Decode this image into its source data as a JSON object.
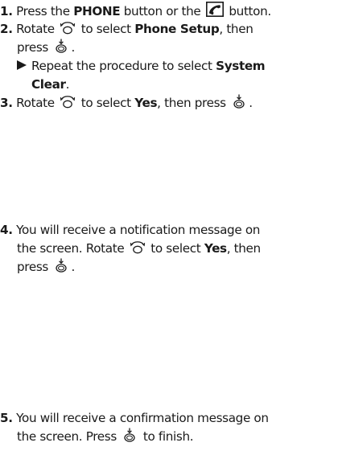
{
  "steps": [
    {
      "number": "1.",
      "lines": [
        {
          "t1": "Press the ",
          "b1": "PHONE",
          "t2": " button or the ",
          "t3": " button."
        }
      ]
    },
    {
      "number": "2.",
      "line1": {
        "t1": "Rotate ",
        "t2": " to select ",
        "b1": "Phone Setup",
        "t3": ", then"
      },
      "line2": {
        "t1": "press ",
        "t2": "."
      },
      "sub": {
        "t1": "Repeat the procedure to select ",
        "b1": "System"
      },
      "sub2": {
        "b1": "Clear",
        "t1": "."
      }
    },
    {
      "number": "3.",
      "line1": {
        "t1": "Rotate ",
        "t2": " to select ",
        "b1": "Yes",
        "t3": ", then press ",
        "t4": "."
      }
    },
    {
      "number": "4.",
      "line1": {
        "t1": "You will receive a notification message on"
      },
      "line2": {
        "t1": "the screen. Rotate ",
        "t2": " to select ",
        "b1": "Yes",
        "t3": ", then"
      },
      "line3": {
        "t1": "press ",
        "t2": "."
      }
    },
    {
      "number": "5.",
      "line1": {
        "t1": "You will receive a confirmation message on"
      },
      "line2": {
        "t1": "the screen. Press ",
        "t2": " to finish."
      }
    }
  ],
  "icons": {
    "phone_button": "phone-handset-icon",
    "rotate_knob": "interface-dial-rotate-icon",
    "press_knob": "interface-dial-press-icon",
    "sub_arrow": "right-triangle-arrow-icon"
  }
}
